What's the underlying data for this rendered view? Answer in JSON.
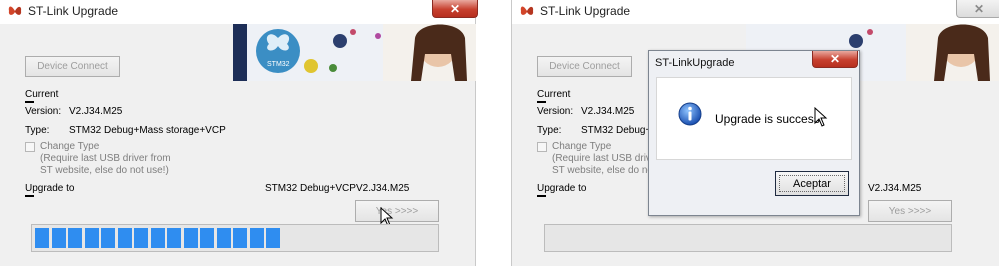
{
  "left_window": {
    "title": "ST-Link Upgrade",
    "close_label": "✕",
    "banner_logo": "STM32",
    "device_connect_label": "Device Connect",
    "current_label": "Current",
    "version_label": "Version:",
    "version_value": "V2.J34.M25",
    "type_label": "Type:",
    "type_value": "STM32 Debug+Mass storage+VCP",
    "change_type_label": "Change Type",
    "change_type_note_1": "(Require last USB driver from",
    "change_type_note_2": "ST website, else do not use!)",
    "upgrade_to_label": "Upgrade to",
    "upgrade_type_value": "STM32 Debug+VCP",
    "upgrade_version_value": "V2.J34.M25",
    "yes_button_label": "Yes >>>>",
    "progress_fraction": 0.63,
    "progress_segments": 15
  },
  "right_window": {
    "title": "ST-Link Upgrade",
    "close_label": "✕",
    "device_connect_label": "Device Connect",
    "current_label": "Current",
    "version_label": "Version:",
    "version_value": "V2.J34.M25",
    "type_label": "Type:",
    "type_value": "STM32 Debug+",
    "change_type_label": "Change Type",
    "change_type_note_1": "(Require last USB driv",
    "change_type_note_2": "ST website, else do no",
    "upgrade_to_label": "Upgrade to",
    "upgrade_version_value": "V2.J34.M25",
    "yes_button_label": "Yes >>>>"
  },
  "dialog": {
    "title": "ST-LinkUpgrade",
    "close_label": "✕",
    "message": "Upgrade is successf",
    "accept_label": "Aceptar",
    "icon": "info-icon"
  },
  "colors": {
    "close_red": "#c7402f",
    "progress_blue": "#2f8df0",
    "window_bg": "#f0f0f0"
  }
}
